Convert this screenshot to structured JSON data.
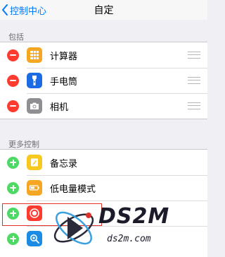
{
  "nav": {
    "back_label": "控制中心",
    "title": "自定"
  },
  "included": {
    "header": "包括",
    "items": [
      {
        "label": "计算器",
        "icon": "calculator-icon",
        "icon_color": "#f5a623"
      },
      {
        "label": "手电筒",
        "icon": "flashlight-icon",
        "icon_color": "#1b6ce4"
      },
      {
        "label": "相机",
        "icon": "camera-icon",
        "icon_color": "#8e8e93"
      }
    ]
  },
  "more": {
    "header": "更多控制",
    "items": [
      {
        "label": "备忘录",
        "icon": "notes-icon",
        "icon_color": "#f7c81e"
      },
      {
        "label": "低电量模式",
        "icon": "battery-icon",
        "icon_color": "#f5a623"
      },
      {
        "label": "",
        "icon": "screen-record-icon",
        "icon_color": "#ff3b30"
      },
      {
        "label": "",
        "icon": "magnifier-icon",
        "icon_color": "#1b8ce6"
      }
    ]
  },
  "watermark": {
    "logo": "DS2M",
    "sub": "ds2m.com"
  },
  "colors": {
    "accent": "#007aff",
    "remove": "#ff3b30",
    "add": "#4cd964"
  }
}
